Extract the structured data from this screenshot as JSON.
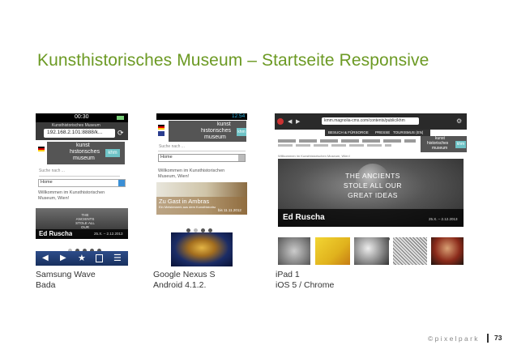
{
  "slide": {
    "title": "Kunsthistorisches Museum – Startseite Responsive",
    "footer_brand": "© p i x e l p a r k",
    "page_number": "73"
  },
  "captions": [
    {
      "line1": "Samsung Wave",
      "line2": "Bada"
    },
    {
      "line1": "Google Nexus S",
      "line2": "Android 4.1.2."
    },
    {
      "line1": "iPad 1",
      "line2": "iOS 5 / Chrome"
    }
  ],
  "samsung": {
    "time": "00:30",
    "tab_title": "Kunsthistorisches Museum",
    "url": "192.168.2.101:8888/k...",
    "logo_lines": [
      "kunst",
      "historisches",
      "museum"
    ],
    "logo_box": "khm",
    "search_placeholder": "Suche nach ...",
    "select_value": "Home",
    "welcome": "Willkommen im Kunsthistorischen Museum, Wien!",
    "hero_text": "Ed Ruscha",
    "hero_date": "25.X. – 2.12.2013",
    "hero_art": "THE ANCIENTS STOLE ALL OUR"
  },
  "nexus": {
    "time": "12:54",
    "logo_lines": [
      "kunst",
      "historisches",
      "museum"
    ],
    "logo_box": "khm",
    "search_placeholder": "Suche nach ...",
    "select_value": "Home",
    "welcome": "Willkommen im Kunsthistorischen Museum, Wien!",
    "hero_title": "Zu Gast in Ambras",
    "hero_sub": "Ein Meisterwerk aus dem Kunsthistorischen Museum Wien",
    "hero_date": "bis 11.11.2012"
  },
  "ipad": {
    "url": "kmm.magnolia-cms.com/contents/public/khm",
    "nav_items": [
      "BESUCH & FÜRSORGE",
      "PRESSE",
      "TOURISMUS (EN)"
    ],
    "logo_lines": [
      "kunst",
      "historisches",
      "museum"
    ],
    "logo_box": "khm",
    "welcome": "Willkommen im Kunsthistorischen Museum, Wien!",
    "hero_art": [
      "THE ANCIENTS",
      "STOLE ALL OUR",
      "GREAT IDEAS"
    ],
    "hero_text": "Ed Ruscha",
    "hero_date": "25.X. – 2.12.2013"
  }
}
